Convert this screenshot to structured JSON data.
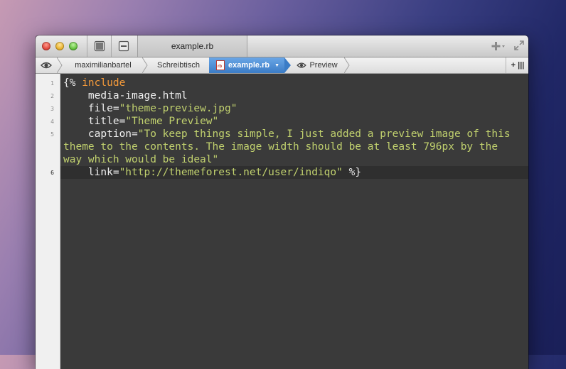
{
  "window": {
    "tab_title": "example.rb"
  },
  "pathbar": {
    "crumbs": [
      "maximilianbartel",
      "Schreibtisch",
      "example.rb",
      "Preview"
    ],
    "add_label": "+ |||"
  },
  "editor": {
    "line_numbers": [
      "1",
      "2",
      "3",
      "4",
      "5",
      "6"
    ],
    "lines": {
      "l1_open": "{%",
      "l1_kw": " include",
      "l2": "    media-image.html",
      "l3_key": "    file",
      "l3_eq": "=",
      "l3_val": "\"theme-preview.jpg\"",
      "l4_key": "    title",
      "l4_eq": "=",
      "l4_val": "\"Theme Preview\"",
      "l5_key": "    caption",
      "l5_eq": "=",
      "l5_val_a": "\"To keep things simple, I just added a preview image of this",
      "l5_val_b": "theme to the contents. The image width should be at least 796px by the",
      "l5_val_c": "way which would be ideal\"",
      "l6_key": "    link",
      "l6_eq": "=",
      "l6_val": "\"http://themeforest.net/user/indiqo\"",
      "l6_close": " %}"
    }
  },
  "colors": {
    "keyword": "#f2993a",
    "string": "#c1d16e",
    "editor_bg": "#3a3a3a",
    "active_crumb": "#3b7cc6"
  }
}
